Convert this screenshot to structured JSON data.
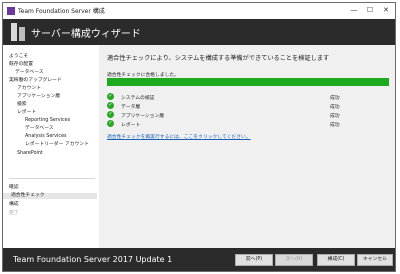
{
  "window": {
    "title": "Team Foundation Server 構成"
  },
  "banner": {
    "title": "サーバー構成ウィザード"
  },
  "nav": {
    "items": [
      {
        "label": "ようこそ",
        "state": "normal"
      },
      {
        "label": "既存の配置",
        "state": "normal"
      },
      {
        "label": "データベース",
        "state": "normal"
      },
      {
        "label": "実稼働のアップグレード",
        "state": "normal"
      },
      {
        "label": "アカウント",
        "state": "normal"
      },
      {
        "label": "アプリケーション層",
        "state": "normal"
      },
      {
        "label": "検索",
        "state": "normal"
      },
      {
        "label": "レポート",
        "state": "normal"
      },
      {
        "label": "Reporting Services",
        "state": "normal"
      },
      {
        "label": "データベース",
        "state": "normal"
      },
      {
        "label": "Analysis Services",
        "state": "normal"
      },
      {
        "label": "レポートリーダー アカウント",
        "state": "normal"
      },
      {
        "label": "SharePoint",
        "state": "normal"
      },
      {
        "label": "確認",
        "state": "normal"
      },
      {
        "label": "適合性チェック",
        "state": "selected"
      },
      {
        "label": "構成",
        "state": "normal"
      },
      {
        "label": "完了",
        "state": "dim"
      }
    ]
  },
  "main": {
    "headline": "適合性チェックにより、システムを構成する準備ができていることを検証します",
    "status": "適合性チェックに合格しました。",
    "progress": 1.0,
    "checks": [
      {
        "name": "システムの検証",
        "result": "成功"
      },
      {
        "name": "データ層",
        "result": "成功"
      },
      {
        "name": "アプリケーション層",
        "result": "成功"
      },
      {
        "name": "レポート",
        "result": "成功"
      }
    ],
    "rerun_link": "適合性チェックを再実行するには、ここをクリックしてください。"
  },
  "footer": {
    "product": "Team Foundation Server 2017 Update 1",
    "buttons": {
      "prev": "前へ(P)",
      "next": "次へ(N)",
      "configure": "構成(C)",
      "cancel": "キャンセル"
    }
  },
  "colors": {
    "progress": "#1ea91e",
    "check": "#2aa52a",
    "banner": "#2b2b2b",
    "link": "#1a5fb4"
  }
}
